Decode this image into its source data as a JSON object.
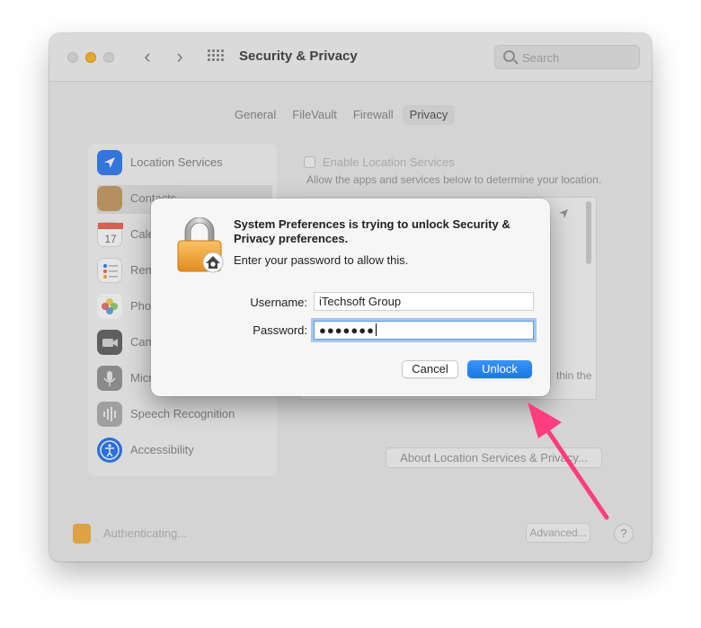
{
  "window": {
    "title": "Security & Privacy",
    "search_placeholder": "Search",
    "traffic_colors": {
      "close": "#dedede",
      "minimize": "#fdbc2e",
      "zoom": "#dedede"
    }
  },
  "tabs": [
    {
      "label": "General",
      "selected": false
    },
    {
      "label": "FileVault",
      "selected": false
    },
    {
      "label": "Firewall",
      "selected": false
    },
    {
      "label": "Privacy",
      "selected": true
    }
  ],
  "sidebar": {
    "items": [
      {
        "label": "Location Services",
        "icon": "location-arrow-icon",
        "color": "#3a82f6"
      },
      {
        "label": "Contacts",
        "icon": "contacts-book-icon",
        "color": "#c9a06a"
      },
      {
        "label": "Cale",
        "icon": "calendar-icon",
        "color": "#ffffff"
      },
      {
        "label": "Rem",
        "icon": "reminders-icon",
        "color": "#ffffff"
      },
      {
        "label": "Pho",
        "icon": "photos-icon",
        "color": "#f4a742"
      },
      {
        "label": "Cam",
        "icon": "camera-icon",
        "color": "#555555"
      },
      {
        "label": "Micr",
        "icon": "microphone-icon",
        "color": "#8a8a8a"
      },
      {
        "label": "Speech Recognition",
        "icon": "waveform-icon",
        "color": "#8a8a8a"
      },
      {
        "label": "Accessibility",
        "icon": "accessibility-icon",
        "color": "#2f7cf6"
      }
    ]
  },
  "location_panel": {
    "enable_label": "Enable Location Services",
    "allow_label": "Allow the apps and services below to determine your location.",
    "within_label": "thin the",
    "about_button": "About Location Services & Privacy..."
  },
  "footer": {
    "auth_label": "Authenticating...",
    "advanced_button": "Advanced...",
    "help_label": "?"
  },
  "dialog": {
    "title": "System Preferences is trying to unlock Security & Privacy preferences.",
    "message": "Enter your password to allow this.",
    "username_label": "Username:",
    "username_value": "iTechsoft Group",
    "password_label": "Password:",
    "password_masked": "●●●●●●●",
    "cancel_label": "Cancel",
    "unlock_label": "Unlock",
    "accent_color": "#1a78e6"
  },
  "annotation": {
    "arrow_color": "#ff3d7f"
  }
}
